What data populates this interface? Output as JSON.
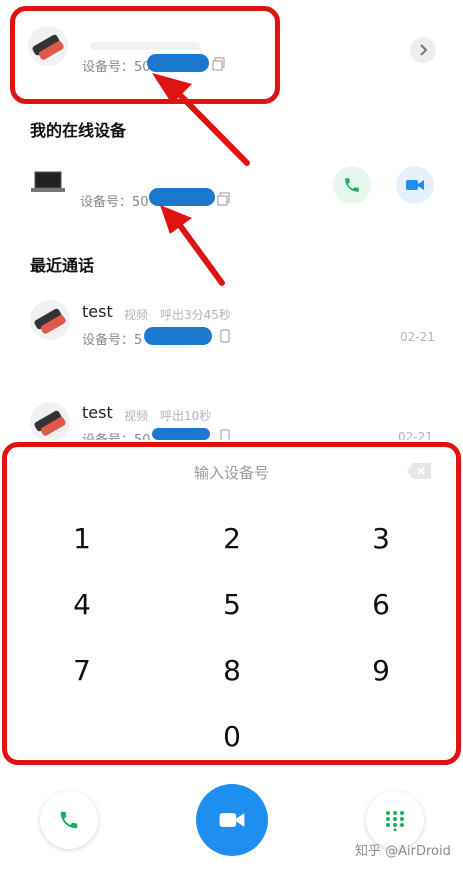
{
  "my_device": {
    "id_label": "设备号：50",
    "chevron": "chevron-right-icon"
  },
  "online_section": {
    "title": "我的在线设备",
    "device": {
      "id_label": "设备号：50"
    }
  },
  "recent_section": {
    "title": "最近通话",
    "calls": [
      {
        "name": "test",
        "type": "视频",
        "detail": "呼出3分45秒",
        "id_label": "设备号：5",
        "date": "02-21"
      },
      {
        "name": "test",
        "type": "视频",
        "detail": "呼出10秒",
        "id_label": "设备号：50",
        "date": "02-21"
      }
    ]
  },
  "dialpad": {
    "placeholder": "输入设备号",
    "keys": [
      "1",
      "2",
      "3",
      "4",
      "5",
      "6",
      "7",
      "8",
      "9",
      "0"
    ]
  },
  "watermark": "知乎 @AirDroid",
  "colors": {
    "accent_blue": "#1e8ff0",
    "call_green": "#19b05a",
    "annotation_red": "#e01212",
    "redaction_blue": "#1b78cf"
  }
}
